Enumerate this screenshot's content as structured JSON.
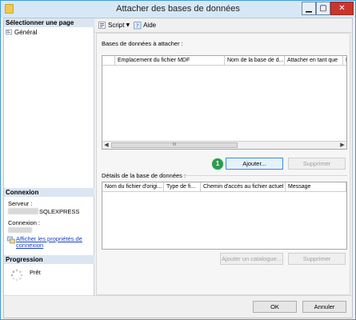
{
  "window": {
    "title": "Attacher des bases de données",
    "min_glyph": "▁",
    "max_glyph": "▢",
    "close_glyph": "✕"
  },
  "left": {
    "select_page_header": "Sélectionner une page",
    "pages": [
      "Général"
    ],
    "connection_header": "Connexion",
    "server_label": "Serveur :",
    "server_value": "SQLEXPRESS",
    "connection_label": "Connexion :",
    "properties_link": "Afficher les propriétés de connexion",
    "progress_header": "Progression",
    "progress_status": "Prêt"
  },
  "toolbar": {
    "script_label": "Script",
    "help_label": "Aide"
  },
  "attach": {
    "group_label": "Bases de données à attacher :",
    "columns": [
      "",
      "Emplacement du fichier MDF",
      "Nom de la base de d...",
      "Attacher en tant que",
      "P"
    ],
    "scroll_thumb": "III",
    "add_button": "Ajouter...",
    "remove_button": "Supprimer",
    "callout_number": "1"
  },
  "details": {
    "group_label": "Détails de la base de données :",
    "columns": [
      "Nom du fichier d'origi...",
      "Type de fi...",
      "Chemin d'accès au fichier actuel",
      "Message"
    ],
    "add_catalog_button": "Ajouter un catalogue...",
    "remove_button": "Supprimer"
  },
  "footer": {
    "ok_button": "OK",
    "cancel_button": "Annuler"
  },
  "colors": {
    "accent": "#3f9ad6",
    "close": "#c9352b",
    "callout": "#2e9b4f",
    "link": "#1a3fc0"
  }
}
